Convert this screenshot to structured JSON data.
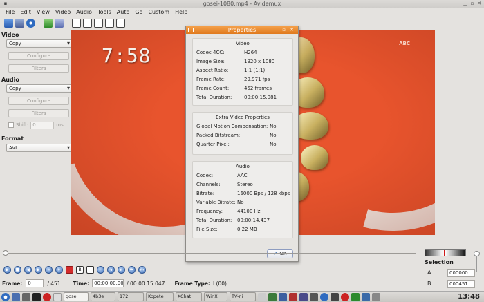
{
  "window": {
    "title": "gosei-1080.mp4 - Avidemux"
  },
  "menu": [
    "File",
    "Edit",
    "View",
    "Video",
    "Audio",
    "Tools",
    "Auto",
    "Go",
    "Custom",
    "Help"
  ],
  "left_panel": {
    "video_header": "Video",
    "video_codec": "Copy",
    "video_configure": "Configure",
    "video_filters": "Filters",
    "audio_header": "Audio",
    "audio_codec": "Copy",
    "audio_configure": "Configure",
    "audio_filters": "Filters",
    "shift_label": "Shift:",
    "shift_value": "0",
    "shift_unit": "ms",
    "format_header": "Format",
    "format_value": "AVI"
  },
  "video_frame": {
    "time_overlay": "7:58",
    "logo_text": "ABC"
  },
  "dialog": {
    "title": "Properties",
    "video": {
      "header": "Video",
      "rows": [
        {
          "k": "Codec 4CC:",
          "v": "H264"
        },
        {
          "k": "Image Size:",
          "v": "1920 x 1080"
        },
        {
          "k": "Aspect Ratio:",
          "v": "1:1 (1:1)"
        },
        {
          "k": "Frame Rate:",
          "v": "29.971 fps"
        },
        {
          "k": "Frame Count:",
          "v": "452 frames"
        },
        {
          "k": "Total Duration:",
          "v": "00:00:15.081"
        }
      ]
    },
    "extra": {
      "header": "Extra Video Properties",
      "rows": [
        {
          "k": "Global Motion Compensation:",
          "v": "No"
        },
        {
          "k": "Packed Bitstream:",
          "v": "No"
        },
        {
          "k": "Quarter Pixel:",
          "v": "No"
        }
      ]
    },
    "audio": {
      "header": "Audio",
      "rows": [
        {
          "k": "Codec:",
          "v": "AAC"
        },
        {
          "k": "Channels:",
          "v": "Stereo"
        },
        {
          "k": "Bitrate:",
          "v": "16000 Bps / 128 kbps"
        },
        {
          "k": "Variable Bitrate:",
          "v": "No"
        },
        {
          "k": "Frequency:",
          "v": "44100 Hz"
        },
        {
          "k": "Total Duration:",
          "v": "00:00:14.437"
        },
        {
          "k": "File Size:",
          "v": "0.22 MB"
        }
      ]
    },
    "ok_label": "OK"
  },
  "footer": {
    "frame_label": "Frame:",
    "frame_value": "0",
    "frame_total": "/ 451",
    "time_label": "Time:",
    "time_value": "00:00:00.000",
    "time_total": "/ 00:00:15.047",
    "frame_type_label": "Frame Type:",
    "frame_type_value": "I (00)"
  },
  "playback": {
    "position_fraction": 0.0
  },
  "selection": {
    "header": "Selection",
    "a_label": "A:",
    "a_value": "000000",
    "b_label": "B:",
    "b_value": "000451"
  },
  "taskbar": {
    "tasks": [
      "gose",
      "4b3e",
      "172.",
      "Kopete",
      "XChat",
      "WinX",
      "TV-ni"
    ],
    "clock": "13:48"
  }
}
